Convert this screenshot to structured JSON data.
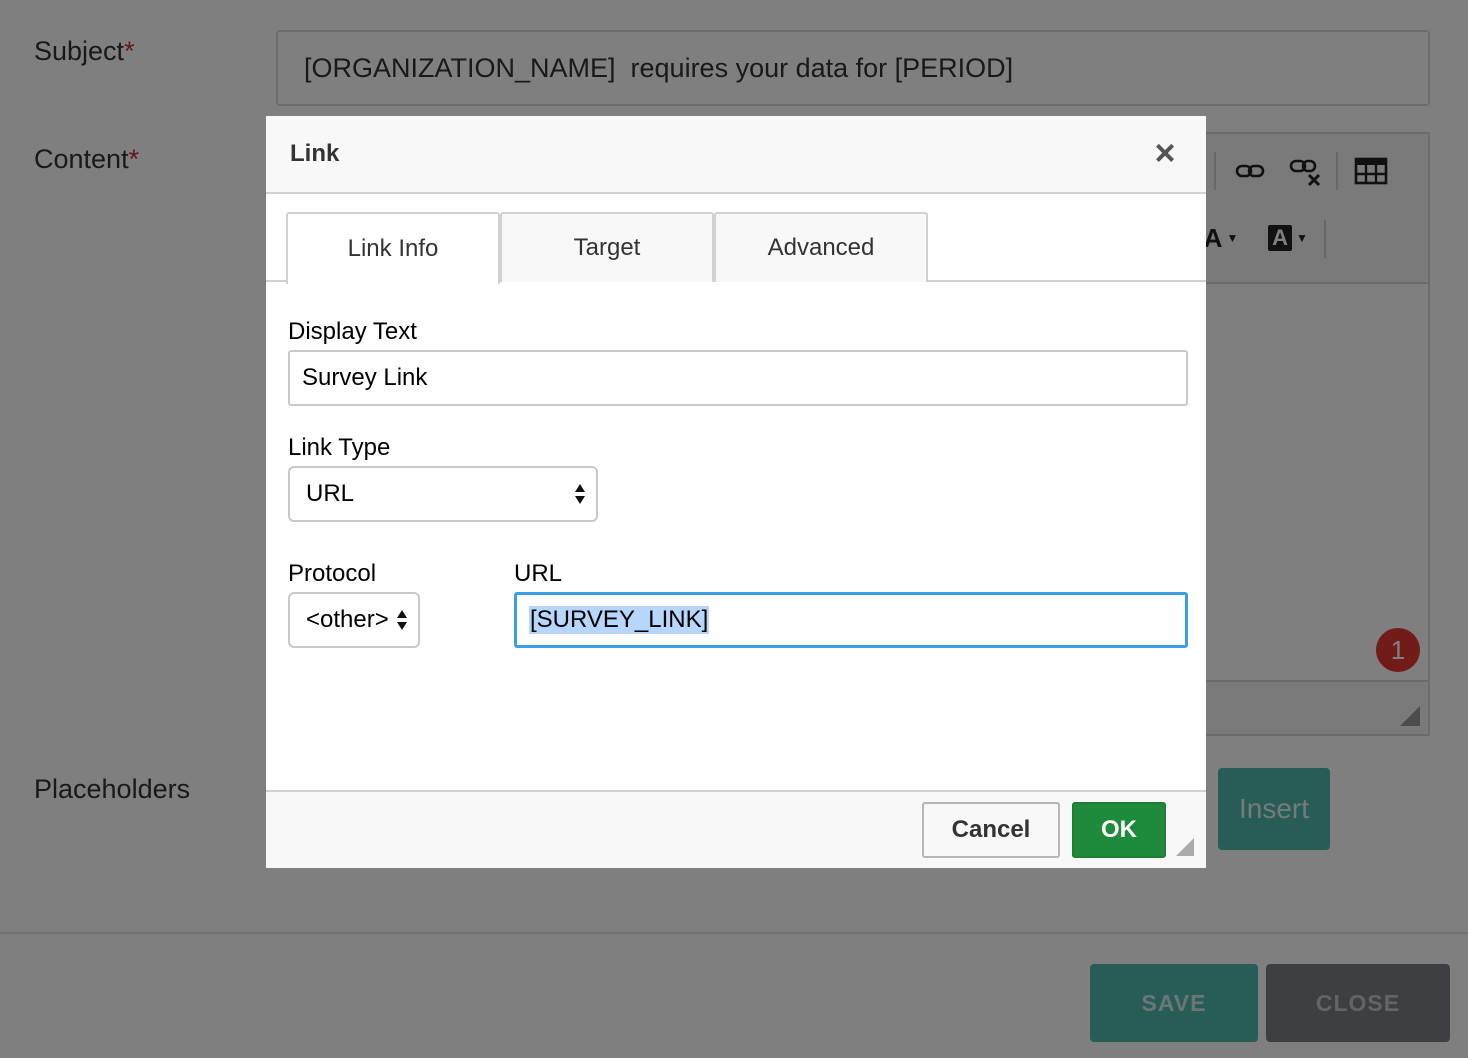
{
  "form": {
    "subject_label": "Subject",
    "content_label": "Content",
    "required_mark": "*",
    "subject_value": "[ORGANIZATION_NAME]  requires your data for [PERIOD]",
    "placeholders_label": "Placeholders",
    "insert_label": "Insert",
    "notification_count": "1"
  },
  "editor_toolbar": {
    "icons": [
      "link-icon",
      "unlink-icon",
      "table-icon",
      "text-color-icon",
      "background-color-icon"
    ],
    "text_color_glyph": "A",
    "bg_color_glyph": "A"
  },
  "footer": {
    "save_label": "SAVE",
    "close_label": "CLOSE"
  },
  "dialog": {
    "title": "Link",
    "close_glyph": "×",
    "tabs": [
      {
        "label": "Link Info",
        "active": true
      },
      {
        "label": "Target",
        "active": false
      },
      {
        "label": "Advanced",
        "active": false
      }
    ],
    "display_text_label": "Display Text",
    "display_text_value": "Survey Link",
    "link_type_label": "Link Type",
    "link_type_value": "URL",
    "protocol_label": "Protocol",
    "protocol_value": "<other>",
    "url_label": "URL",
    "url_value": "[SURVEY_LINK]",
    "cancel_label": "Cancel",
    "ok_label": "OK"
  },
  "colors": {
    "accent_teal": "#4fb8ae",
    "ok_green": "#1e8a3c",
    "focus_blue": "#3a9fe6",
    "required_red": "#c9302c",
    "badge_red": "#e53935"
  }
}
